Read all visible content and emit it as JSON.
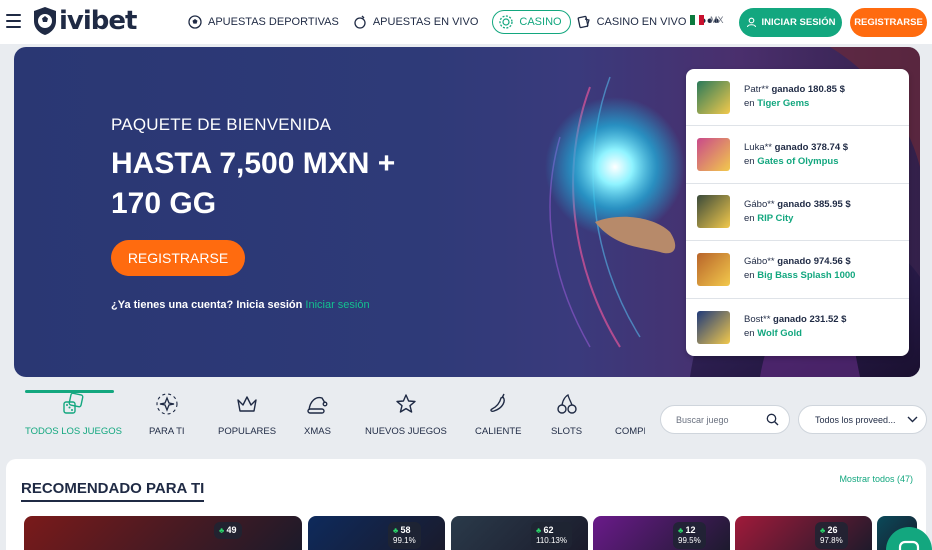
{
  "header": {
    "logo_text": "ivibet",
    "nav": [
      {
        "label": "APUESTAS DEPORTIVAS",
        "icon": "soccer-ball-icon"
      },
      {
        "label": "APUESTAS EN VIVO",
        "icon": "live-ball-icon"
      },
      {
        "label": "CASINO",
        "icon": "casino-chip-icon",
        "active": true
      },
      {
        "label": "CASINO EN VIVO",
        "icon": "live-casino-icon"
      }
    ],
    "more": "•••",
    "lang": "MX",
    "login_label": "INICIAR SESIÓN",
    "register_label": "REGISTRARSE"
  },
  "banner": {
    "subtitle": "PAQUETE DE BIENVENIDA",
    "title": "HASTA 7,500 MXN + 170 GG",
    "register_label": "REGISTRARSE",
    "login_prompt": "¿Ya tienes una cuenta? Inicia sesión",
    "login_link": "Iniciar sesión"
  },
  "winners": [
    {
      "user": "Patr**",
      "won_label": "ganado",
      "amount": "180.85 $",
      "in": "en",
      "game": "Tiger Gems",
      "color": "#2a7a5a"
    },
    {
      "user": "Luka**",
      "won_label": "ganado",
      "amount": "378.74 $",
      "in": "en",
      "game": "Gates of Olympus",
      "color": "#c9498a"
    },
    {
      "user": "Gábo**",
      "won_label": "ganado",
      "amount": "385.95 $",
      "in": "en",
      "game": "RIP City",
      "color": "#3a4a3a"
    },
    {
      "user": "Gábo**",
      "won_label": "ganado",
      "amount": "974.56 $",
      "in": "en",
      "game": "Big Bass Splash 1000",
      "color": "#b8642a"
    },
    {
      "user": "Bost**",
      "won_label": "ganado",
      "amount": "231.52 $",
      "in": "en",
      "game": "Wolf Gold",
      "color": "#1f3a7a"
    }
  ],
  "categories": [
    {
      "label": "TODOS LOS JUEGOS",
      "icon": "dice-icon",
      "active": true
    },
    {
      "label": "PARA TI",
      "icon": "sparkle-star-icon"
    },
    {
      "label": "POPULARES",
      "icon": "crown-icon"
    },
    {
      "label": "XMAS",
      "icon": "santa-hat-icon"
    },
    {
      "label": "NUEVOS JUEGOS",
      "icon": "star-icon"
    },
    {
      "label": "CALIENTE",
      "icon": "chili-icon"
    },
    {
      "label": "SLOTS",
      "icon": "cherries-icon"
    },
    {
      "label": "COMPI",
      "icon": "trophy-icon"
    }
  ],
  "search": {
    "placeholder": "Buscar juego"
  },
  "provider": {
    "placeholder": "Todos los proveed..."
  },
  "recommended": {
    "title": "RECOMENDADO PARA TI",
    "show_all": "Mostrar todos",
    "count": "(47)",
    "tiles": [
      {
        "players": "49",
        "rtp": "",
        "color": "#7a1a1a"
      },
      {
        "players": "58",
        "rtp": "99.1%",
        "color": "#0e2a5c"
      },
      {
        "players": "62",
        "rtp": "110.13%",
        "color": "#2a3a4a"
      },
      {
        "players": "12",
        "rtp": "99.5%",
        "color": "#6a1a8a"
      },
      {
        "players": "26",
        "rtp": "97.8%",
        "color": "#a01a3a"
      },
      {
        "players": "",
        "rtp": "",
        "color": "#0a4a5a"
      }
    ]
  }
}
